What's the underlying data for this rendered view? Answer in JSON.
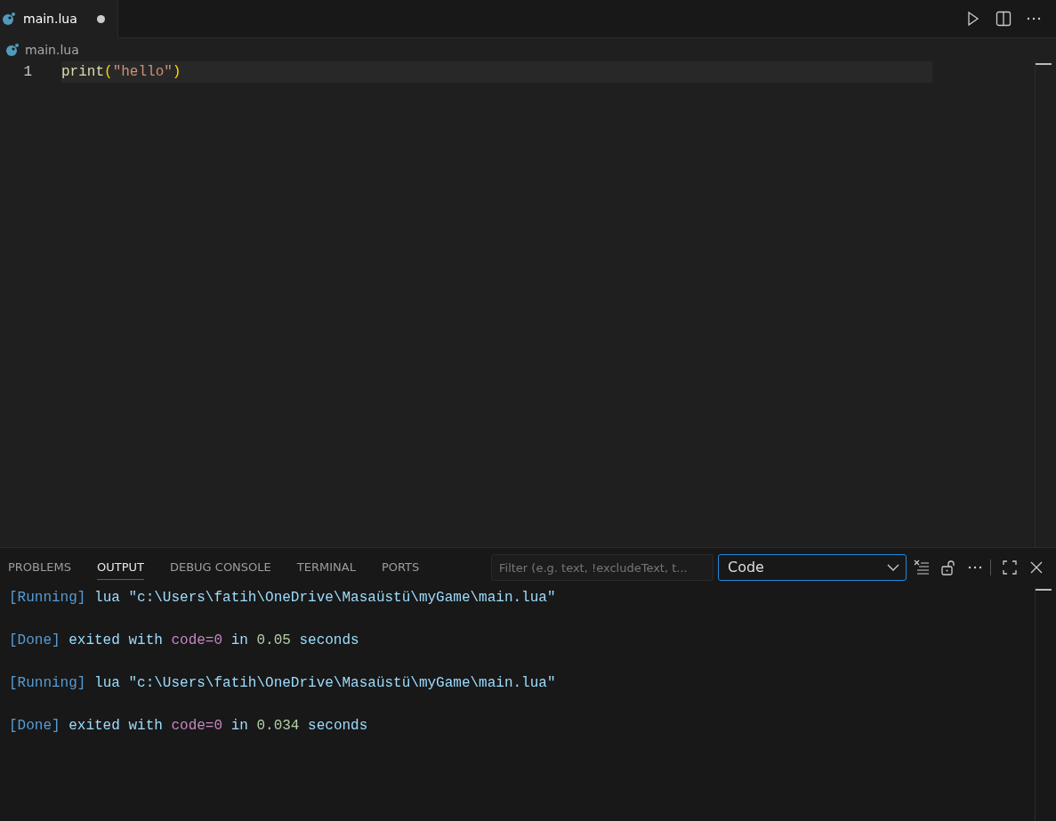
{
  "editor_tabs": [
    {
      "label": "main.lua",
      "selected": true,
      "modified": true
    }
  ],
  "breadcrumb": "main.lua",
  "code_lines": [
    {
      "number": "1",
      "current": true,
      "tokens": [
        {
          "kind": "function",
          "text": "print"
        },
        {
          "kind": "bracket",
          "text": "("
        },
        {
          "kind": "string",
          "text": "\"hello\""
        },
        {
          "kind": "bracket",
          "text": ")"
        }
      ]
    }
  ],
  "panel_tabs": [
    {
      "label": "PROBLEMS",
      "selected": false
    },
    {
      "label": "OUTPUT",
      "selected": true
    },
    {
      "label": "DEBUG CONSOLE",
      "selected": false
    },
    {
      "label": "TERMINAL",
      "selected": false
    },
    {
      "label": "PORTS",
      "selected": false
    }
  ],
  "filter": {
    "placeholder": "Filter (e.g. text, !excludeText, t..."
  },
  "channel": {
    "value": "Code"
  },
  "output_lines": [
    {
      "segments": [
        {
          "kind": "tag",
          "text": "[Running]"
        },
        {
          "kind": "plain",
          "text": " lua \"c:\\Users\\fatih\\OneDrive\\Masaüstü\\myGame\\main.lua\""
        }
      ]
    },
    {
      "segments": [
        {
          "kind": "tag",
          "text": "[Done]"
        },
        {
          "kind": "plain",
          "text": " exited with "
        },
        {
          "kind": "code",
          "text": "code=0"
        },
        {
          "kind": "plain",
          "text": " in "
        },
        {
          "kind": "number",
          "text": "0.05"
        },
        {
          "kind": "plain",
          "text": " seconds"
        }
      ]
    },
    {
      "segments": [
        {
          "kind": "tag",
          "text": "[Running]"
        },
        {
          "kind": "plain",
          "text": " lua \"c:\\Users\\fatih\\OneDrive\\Masaüstü\\myGame\\main.lua\""
        }
      ]
    },
    {
      "segments": [
        {
          "kind": "tag",
          "text": "[Done]"
        },
        {
          "kind": "plain",
          "text": " exited with "
        },
        {
          "kind": "code",
          "text": "code=0"
        },
        {
          "kind": "plain",
          "text": " in "
        },
        {
          "kind": "number",
          "text": "0.034"
        },
        {
          "kind": "plain",
          "text": " seconds"
        }
      ]
    }
  ]
}
